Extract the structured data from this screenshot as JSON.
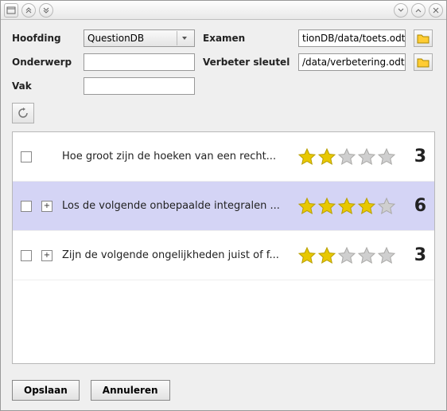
{
  "titlebar": {},
  "form": {
    "hoofding_label": "Hoofding",
    "hoofding_value": "QuestionDB",
    "examen_label": "Examen",
    "examen_value": "tionDB/data/toets.odt",
    "onderwerp_label": "Onderwerp",
    "onderwerp_value": "",
    "verbeter_label": "Verbeter sleutel",
    "verbeter_value": "/data/verbetering.odt",
    "vak_label": "Vak",
    "vak_value": ""
  },
  "rows": [
    {
      "expand": false,
      "text": "Hoe groot zijn de hoeken van een recht...",
      "stars": 2,
      "count": "3"
    },
    {
      "expand": true,
      "text": "Los de volgende onbepaalde integralen ...",
      "stars": 4,
      "count": "6",
      "selected": true
    },
    {
      "expand": true,
      "text": "Zijn de volgende ongelijkheden juist of f...",
      "stars": 2,
      "count": "3"
    }
  ],
  "footer": {
    "save": "Opslaan",
    "cancel": "Annuleren"
  }
}
